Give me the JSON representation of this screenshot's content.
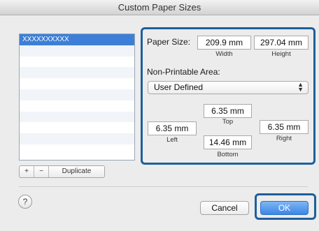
{
  "window": {
    "title": "Custom Paper Sizes"
  },
  "paper_list": {
    "items": [
      "XXXXXXXXXX",
      "",
      "",
      "",
      "",
      "",
      "",
      "",
      "",
      "",
      ""
    ]
  },
  "list_buttons": {
    "add": "+",
    "remove": "−",
    "duplicate": "Duplicate"
  },
  "paper_size": {
    "label": "Paper Size:",
    "width_value": "209.9 mm",
    "width_caption": "Width",
    "height_value": "297.04 mm",
    "height_caption": "Height"
  },
  "non_printable": {
    "label": "Non-Printable Area:",
    "preset": "User Defined",
    "top_value": "6.35 mm",
    "top_caption": "Top",
    "left_value": "6.35 mm",
    "left_caption": "Left",
    "right_value": "6.35 mm",
    "right_caption": "Right",
    "bottom_value": "14.46 mm",
    "bottom_caption": "Bottom"
  },
  "footer": {
    "help": "?",
    "cancel": "Cancel",
    "ok": "OK"
  },
  "colors": {
    "accent": "#1f5f9c",
    "selection": "#3d7fd6",
    "ok_button": "#3a86e6"
  }
}
